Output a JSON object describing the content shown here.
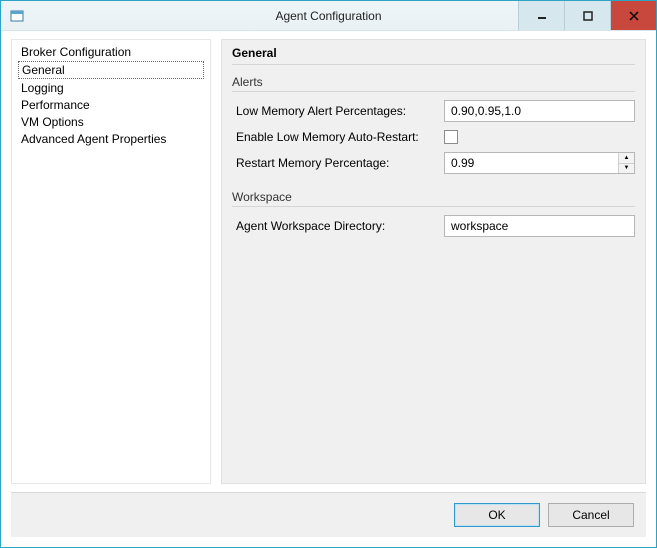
{
  "window": {
    "title": "Agent Configuration"
  },
  "sidebar": {
    "items": [
      {
        "label": "Broker Configuration",
        "selected": false
      },
      {
        "label": "General",
        "selected": true
      },
      {
        "label": "Logging",
        "selected": false
      },
      {
        "label": "Performance",
        "selected": false
      },
      {
        "label": "VM Options",
        "selected": false
      },
      {
        "label": "Advanced Agent Properties",
        "selected": false
      }
    ]
  },
  "content": {
    "heading": "General",
    "groups": {
      "alerts": {
        "title": "Alerts",
        "lowMemoryLabel": "Low Memory Alert Percentages:",
        "lowMemoryValue": "0.90,0.95,1.0",
        "autoRestartLabel": "Enable Low Memory Auto-Restart:",
        "autoRestartChecked": false,
        "restartPercentLabel": "Restart Memory Percentage:",
        "restartPercentValue": "0.99"
      },
      "workspace": {
        "title": "Workspace",
        "workspaceDirLabel": "Agent Workspace Directory:",
        "workspaceDirValue": "workspace"
      }
    }
  },
  "footer": {
    "okLabel": "OK",
    "cancelLabel": "Cancel"
  }
}
